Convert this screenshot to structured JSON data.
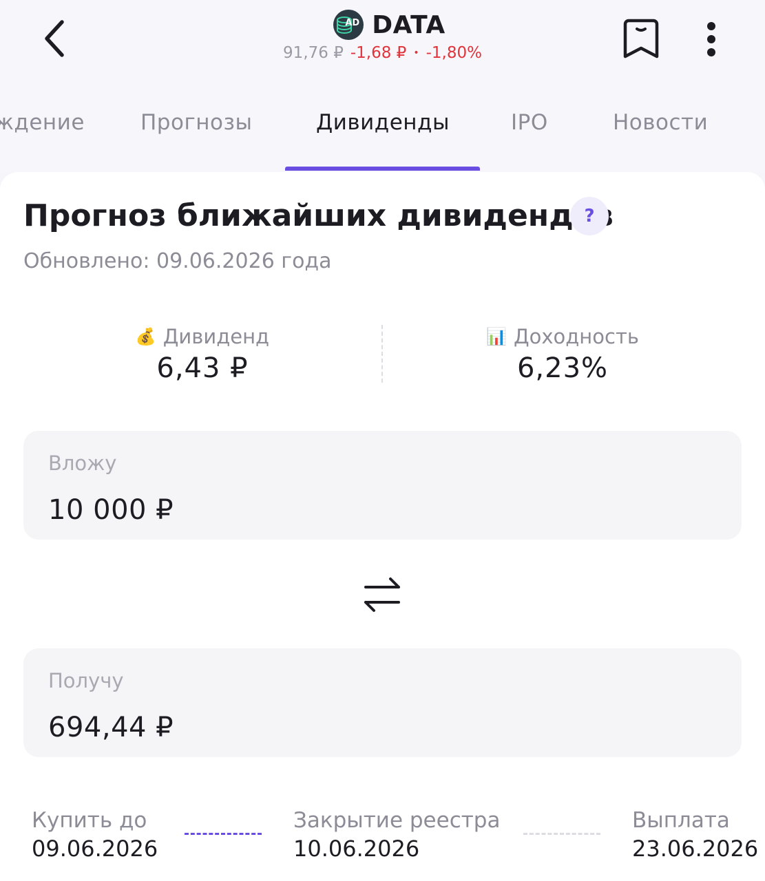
{
  "header": {
    "ticker": "DATA",
    "logo_text": "AD",
    "price": "91,76 ₽",
    "change_abs": "-1,68 ₽",
    "separator": "•",
    "change_pct": "-1,80%",
    "icons": {
      "back": "chevron-left-icon",
      "bookmark": "bookmark-icon",
      "more": "more-vertical-icon"
    }
  },
  "tabs": [
    {
      "label": "ждение",
      "active": false
    },
    {
      "label": "Прогнозы",
      "active": false
    },
    {
      "label": "Дивиденды",
      "active": true
    },
    {
      "label": "IPO",
      "active": false
    },
    {
      "label": "Новости",
      "active": false
    }
  ],
  "forecast": {
    "title": "Прогноз ближайших дивидендов",
    "help": "?",
    "updated": "Обновлено: 09.06.2026 года",
    "dividend": {
      "icon": "💰",
      "label": "Дивиденд",
      "value": "6,43 ₽"
    },
    "yield": {
      "icon": "📊",
      "label": "Доходность",
      "value": "6,23%"
    }
  },
  "calculator": {
    "invest_label": "Вложу",
    "invest_value": "10 000 ₽",
    "receive_label": "Получу",
    "receive_value": "694,44 ₽",
    "swap_icon": "swap-arrows-icon"
  },
  "timeline": [
    {
      "label": "Купить до",
      "date": "09.06.2026"
    },
    {
      "label": "Закрытие реестра",
      "date": "10.06.2026"
    },
    {
      "label": "Выплата",
      "date": "23.06.2026"
    }
  ],
  "colors": {
    "accent": "#6a4ee2",
    "negative": "#e0343c",
    "muted": "#8c8c96"
  }
}
